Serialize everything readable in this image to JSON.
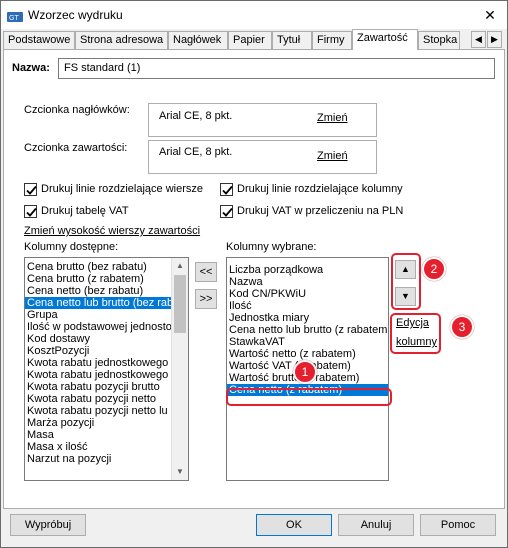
{
  "window": {
    "title": "Wzorzec wydruku",
    "close": "✕"
  },
  "tabs": [
    "Podstawowe",
    "Strona adresowa",
    "Nagłówek",
    "Papier",
    "Tytuł",
    "Firmy",
    "Zawartość",
    "Stopka"
  ],
  "tab_scroll": {
    "left": "◀",
    "right": "▶"
  },
  "name": {
    "label": "Nazwa:",
    "value": "FS standard (1)"
  },
  "fonts": {
    "header_label": "Czcionka nagłówków:",
    "header_value": "Arial CE, 8 pkt.",
    "content_label": "Czcionka zawartości:",
    "content_value": "Arial CE, 8 pkt.",
    "change": "Zmień"
  },
  "checkboxes": {
    "row_lines": "Drukuj linie rozdzielające wiersze",
    "col_lines": "Drukuj linie rozdzielające kolumny",
    "vat_table": "Drukuj tabelę VAT",
    "vat_pln": "Drukuj VAT w przeliczeniu na PLN"
  },
  "row_height_link": "Zmień wysokość wierszy zawartości",
  "available": {
    "label": "Kolumny dostępne:",
    "items": [
      "Cena brutto (bez rabatu)",
      "Cena brutto (z rabatem)",
      "Cena netto (bez rabatu)",
      "Cena netto lub brutto (bez rab",
      "Grupa",
      "Ilość w podstawowej jednosto",
      "Kod dostawy",
      "KosztPozycji",
      "Kwota rabatu jednostkowego",
      "Kwota rabatu jednostkowego",
      "Kwota rabatu pozycji brutto",
      "Kwota rabatu pozycji netto",
      "Kwota rabatu pozycji netto lu",
      "Marża pozycji",
      "Masa",
      "Masa x ilość",
      "Narzut na pozycji"
    ]
  },
  "transfer": {
    "to_left": "<<",
    "to_right": ">>"
  },
  "selected": {
    "label": "Kolumny wybrane:",
    "items": [
      "Liczba porządkowa",
      "Nazwa",
      "Kod CN/PKWiU",
      "Ilość",
      "Jednostka miary",
      "Cena netto lub brutto (z rabatem",
      "StawkaVAT",
      "Wartość netto (z rabatem)",
      "Wartość VAT (z rabatem)",
      "Wartość brutto (z rabatem)",
      "Cena netto (z rabatem)"
    ]
  },
  "move": {
    "up": "▲",
    "down": "▼"
  },
  "edit_column": {
    "line1": "Edycja",
    "line2": "kolumny"
  },
  "badges": [
    "1",
    "2",
    "3"
  ],
  "footer": {
    "preview": "Wypróbuj",
    "ok": "OK",
    "cancel": "Anuluj",
    "help": "Pomoc"
  },
  "colors": {
    "selection": "#0078d7",
    "callout": "#e5202e"
  }
}
